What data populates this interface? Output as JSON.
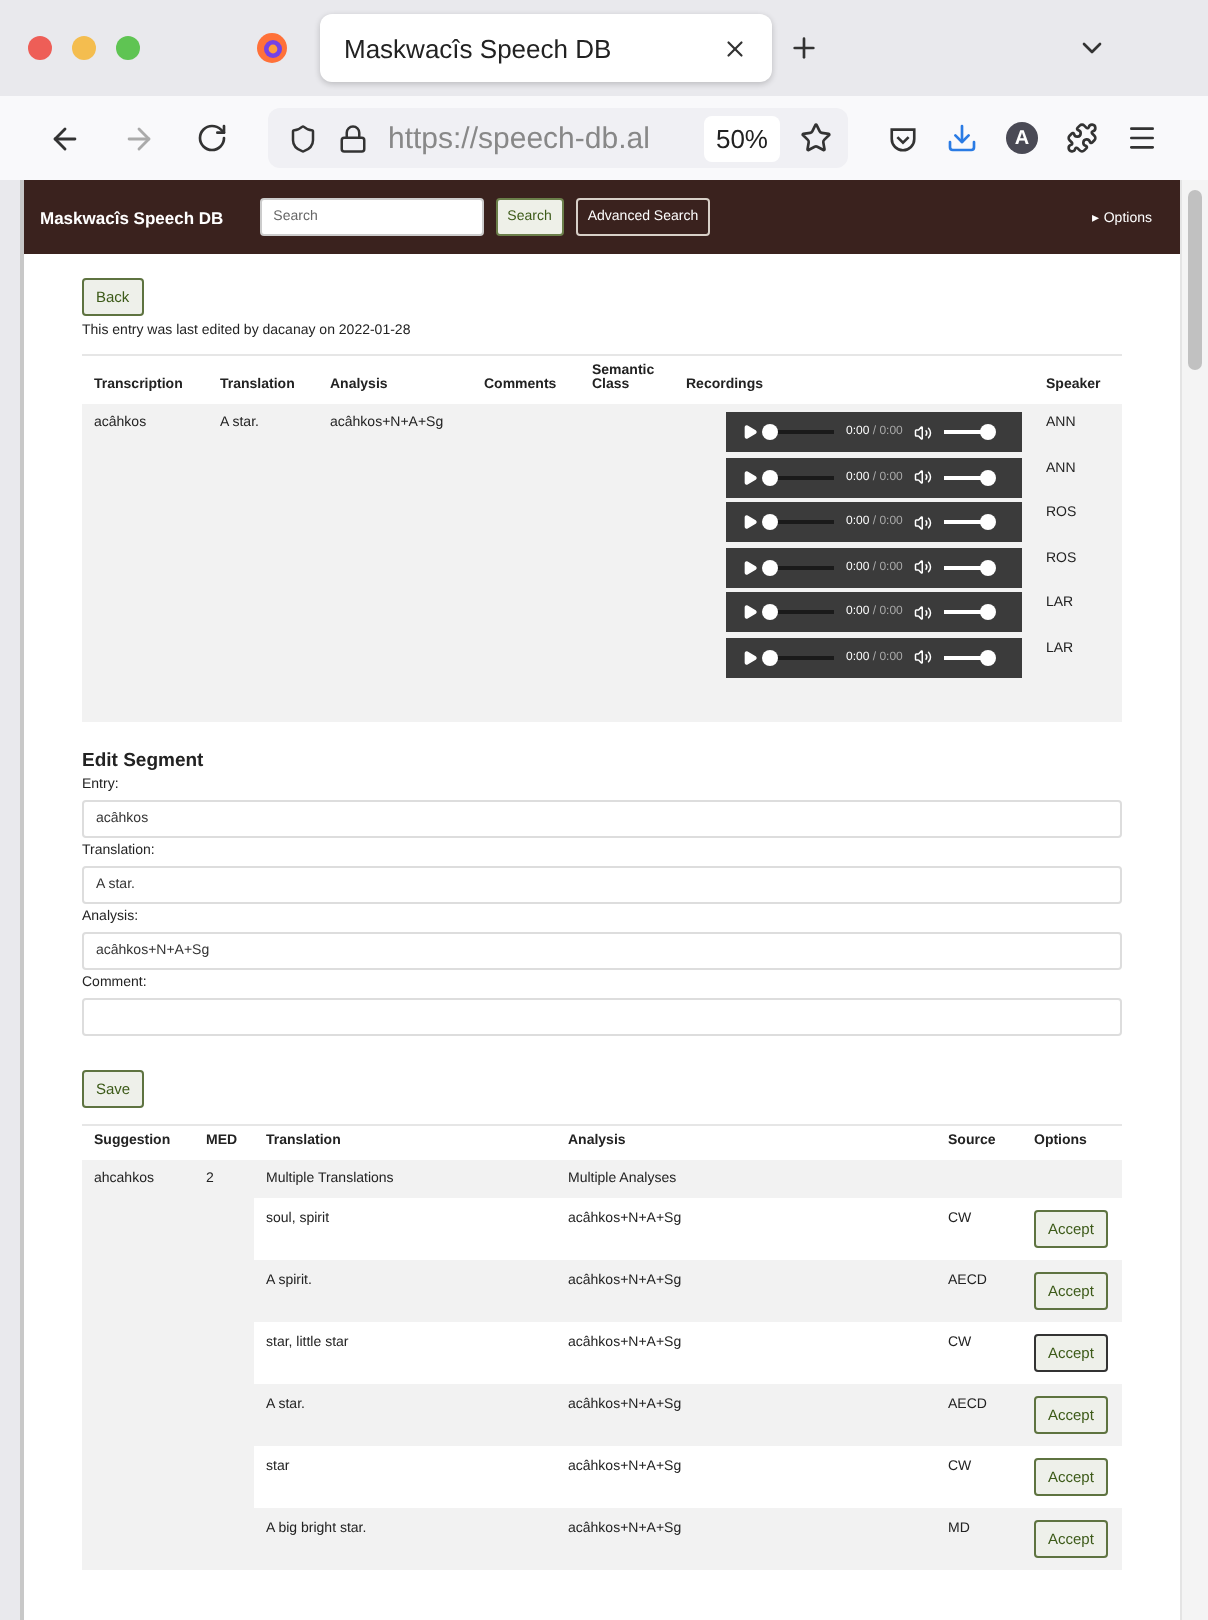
{
  "browser": {
    "tab_title": "Maskwacîs Speech DB",
    "url": "https://speech-db.al",
    "zoom": "50%",
    "account_initial": "A"
  },
  "navbar": {
    "brand": "Maskwacîs Speech DB",
    "search": {
      "placeholder": "Search"
    },
    "search_button": "Search",
    "advanced_button": "Advanced Search",
    "options": "▸ Options"
  },
  "back_button": "Back",
  "edit_notice": "This entry was last edited by dacanay on 2022-01-28",
  "entry_table": {
    "columns": [
      "Transcription",
      "Translation",
      "Analysis",
      "Comments",
      "Semantic Class",
      "Recordings",
      "Speaker"
    ],
    "row": {
      "transcription": "acâhkos",
      "translation": "A star.",
      "analysis": "acâhkos+N+A+Sg",
      "recordings": [
        {
          "time": "0:00",
          "duration": "/ 0:00",
          "level": 0,
          "volume": {
            "level": 1
          },
          "speaker": "ANN"
        },
        {
          "time": "0:00",
          "duration": "/ 0:00",
          "level": 0,
          "volume": {
            "level": 1
          },
          "speaker": "ANN"
        },
        {
          "time": "0:00",
          "duration": "/ 0:00",
          "level": 0,
          "volume": {
            "level": 1
          },
          "speaker": "ROS"
        },
        {
          "time": "0:00",
          "duration": "/ 0:00",
          "level": 0,
          "volume": {
            "level": 1
          },
          "speaker": "ROS"
        },
        {
          "time": "0:00",
          "duration": "/ 0:00",
          "level": 0,
          "volume": {
            "level": 1
          },
          "speaker": "LAR"
        },
        {
          "time": "0:00",
          "duration": "/ 0:00",
          "level": 0,
          "volume": {
            "level": 1
          },
          "speaker": "LAR"
        }
      ]
    }
  },
  "edit_segment": {
    "title": "Edit Segment",
    "fields": [
      {
        "label": "Entry:",
        "value": "acâhkos"
      },
      {
        "label": "Translation:",
        "value": "A star."
      },
      {
        "label": "Analysis:",
        "value": "acâhkos+N+A+Sg"
      },
      {
        "label": "Comment:"
      }
    ],
    "save_button": "Save"
  },
  "suggestion_table": {
    "columns": [
      "Suggestion",
      "MED",
      "Translation",
      "Analysis",
      "Source",
      "Options"
    ],
    "suggestion": "ahcahkos",
    "med": "2",
    "translation": "Multiple Translations",
    "analysis": "Multiple Analyses",
    "rows": [
      {
        "translation": "soul, spirit",
        "analysis": "acâhkos+N+A+Sg",
        "source": "CW",
        "action": "Accept",
        "focused": false
      },
      {
        "translation": "A spirit.",
        "analysis": "acâhkos+N+A+Sg",
        "source": "AECD",
        "action": "Accept",
        "focused": false
      },
      {
        "translation": "star, little star",
        "analysis": "acâhkos+N+A+Sg",
        "source": "CW",
        "action": "Accept",
        "focused": true
      },
      {
        "translation": "A star.",
        "analysis": "acâhkos+N+A+Sg",
        "source": "AECD",
        "action": "Accept",
        "focused": false
      },
      {
        "translation": "star",
        "analysis": "acâhkos+N+A+Sg",
        "source": "CW",
        "action": "Accept",
        "focused": false
      },
      {
        "translation": "A big bright star.",
        "analysis": "acâhkos+N+A+Sg",
        "source": "MD",
        "action": "Accept",
        "focused": false
      }
    ]
  }
}
